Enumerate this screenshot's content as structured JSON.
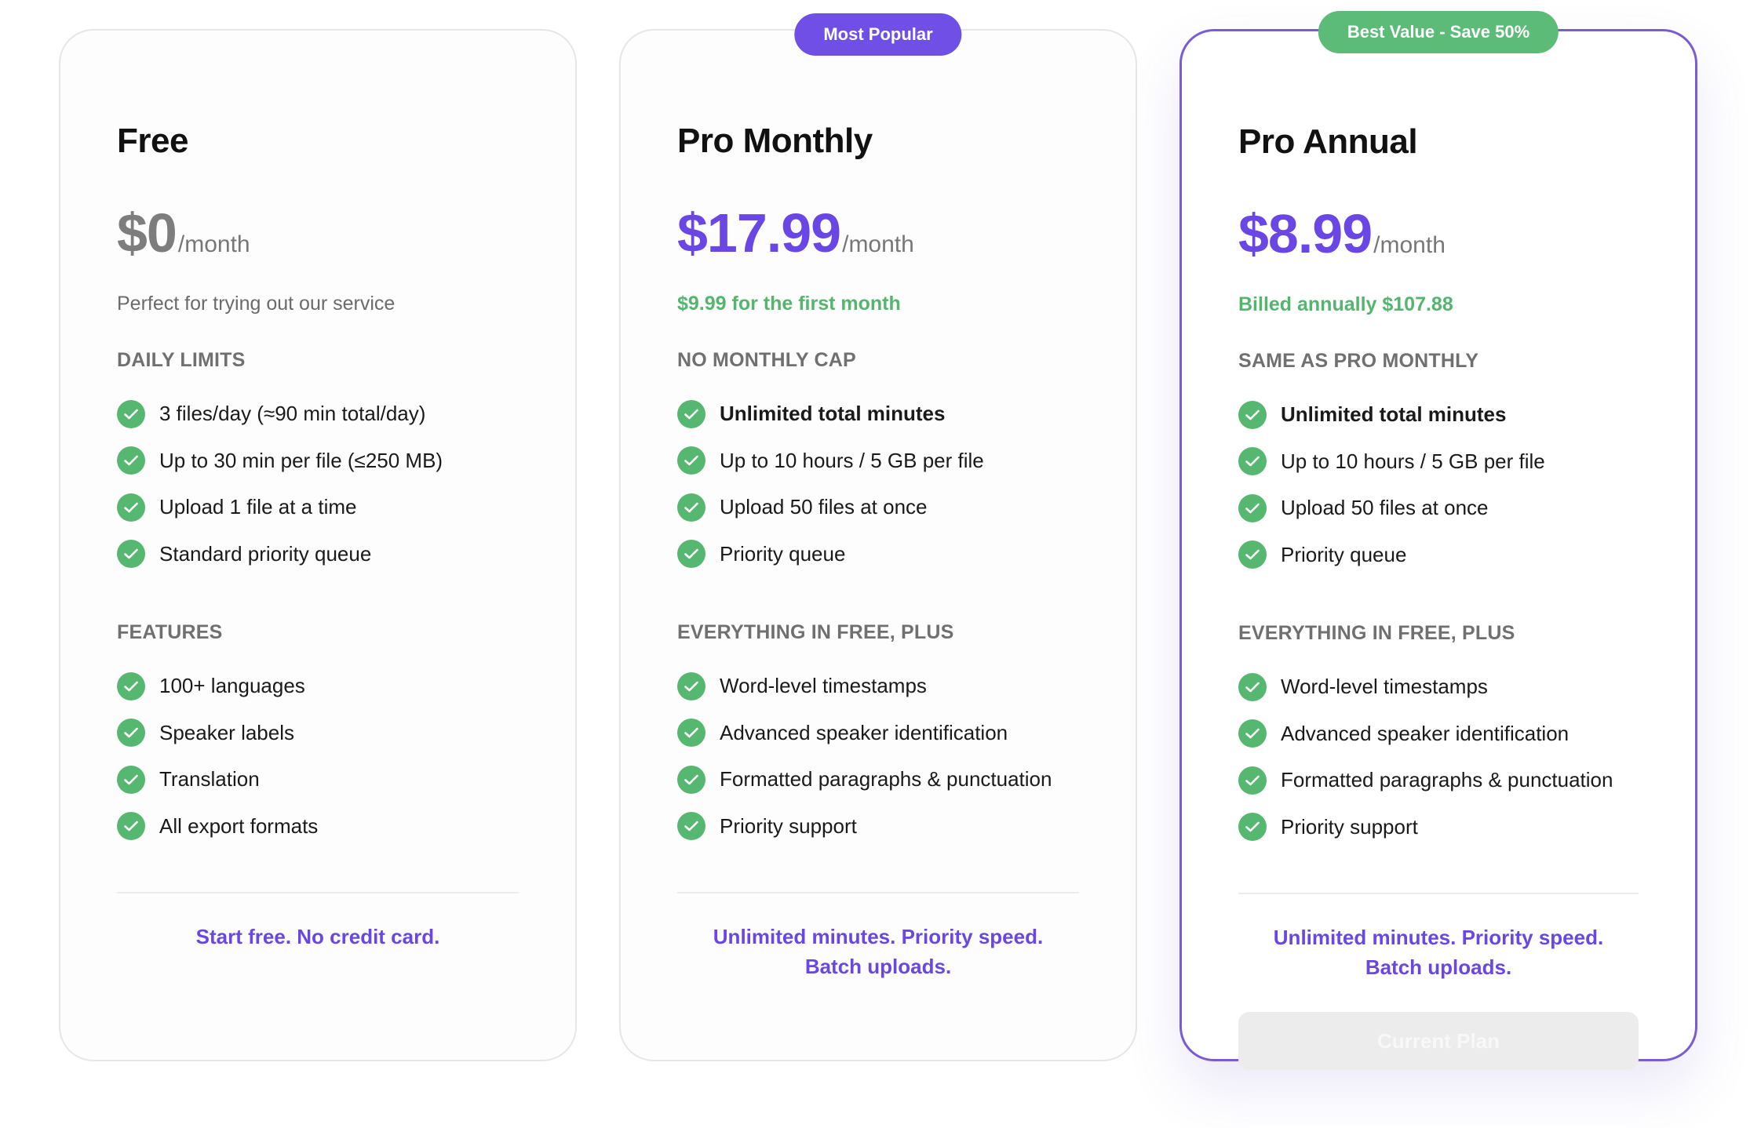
{
  "plans": [
    {
      "name": "Free",
      "ribbon": "",
      "price": "$0",
      "per": "/month",
      "sub": "Perfect for trying out our service",
      "section1": "DAILY LIMITS",
      "features1": [
        "3 files/day (≈90 min total/day)",
        "Up to 30 min per file (≤250 MB)",
        "Upload 1 file at a time",
        "Standard priority queue"
      ],
      "section2": "FEATURES",
      "features2": [
        "100+ languages",
        "Speaker labels",
        "Translation",
        "All export formats"
      ],
      "tagline": "Start free. No credit card."
    },
    {
      "name": "Pro Monthly",
      "ribbon": "Most Popular",
      "price": "$17.99",
      "per": "/month",
      "sub": "$9.99 for the first month",
      "section1": "NO MONTHLY CAP",
      "features1": [
        "Unlimited total minutes",
        "Up to 10 hours / 5 GB per file",
        "Upload 50 files at once",
        "Priority queue"
      ],
      "section2": "EVERYTHING IN FREE, PLUS",
      "features2": [
        "Word-level timestamps",
        "Advanced speaker identification",
        "Formatted paragraphs & punctuation",
        "Priority support"
      ],
      "tagline": "Unlimited minutes. Priority speed. Batch uploads."
    },
    {
      "name": "Pro Annual",
      "ribbon": "Best Value - Save 50%",
      "price": "$8.99",
      "per": "/month",
      "sub": "Billed annually $107.88",
      "section1": "SAME AS PRO MONTHLY",
      "features1": [
        "Unlimited total minutes",
        "Up to 10 hours / 5 GB per file",
        "Upload 50 files at once",
        "Priority queue"
      ],
      "section2": "EVERYTHING IN FREE, PLUS",
      "features2": [
        "Word-level timestamps",
        "Advanced speaker identification",
        "Formatted paragraphs & punctuation",
        "Priority support"
      ],
      "tagline": "Unlimited minutes. Priority speed. Batch uploads.",
      "cta": "Current Plan"
    }
  ],
  "colors": {
    "accent_purple": "#6a46e4",
    "success_green": "#56b870",
    "selected_border": "#7a5bd6"
  },
  "icons": {
    "feature_check": "check-circle-icon"
  }
}
